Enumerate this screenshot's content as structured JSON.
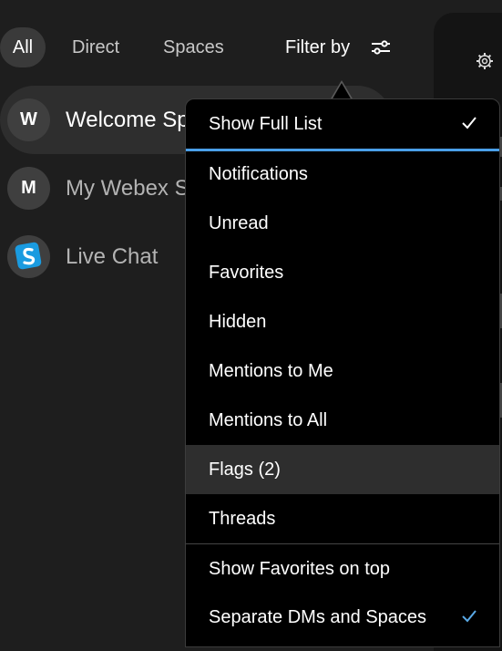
{
  "tabs": {
    "all": "All",
    "direct": "Direct",
    "spaces": "Spaces",
    "filter_by": "Filter by"
  },
  "spaces_list": [
    {
      "initial": "W",
      "name": "Welcome Sp"
    },
    {
      "initial": "M",
      "name": "My Webex S"
    },
    {
      "icon": "webex-chat-logo-icon",
      "name": "Live Chat"
    }
  ],
  "filter_menu": {
    "show_full_list": "Show Full List",
    "notifications": "Notifications",
    "unread": "Unread",
    "favorites": "Favorites",
    "hidden": "Hidden",
    "mentions_to_me": "Mentions to Me",
    "mentions_to_all": "Mentions to All",
    "flags": "Flags (2)",
    "threads": "Threads",
    "show_favorites_on_top": "Show Favorites on top",
    "separate_dms_and_spaces": "Separate DMs and Spaces"
  },
  "colors": {
    "accent": "#4a9fe8",
    "check_active": "#5aa9e6",
    "background": "#1e1e1e",
    "menu_bg": "#000000"
  }
}
